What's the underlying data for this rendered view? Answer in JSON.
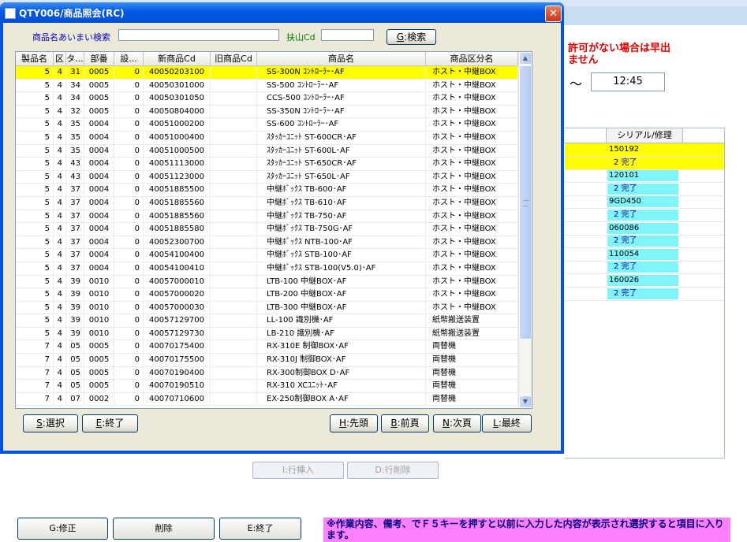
{
  "background": {
    "warning": "許可がない場合は早出\nません",
    "time_tilde": "～",
    "time_value": "12:45",
    "grid_header": "シリアル/修理",
    "grid_rows": [
      {
        "text": "150192",
        "hl": true,
        "cyan": false,
        "status": false
      },
      {
        "text": "2 完了",
        "hl": true,
        "cyan": false,
        "status": true
      },
      {
        "text": "120101",
        "hl": false,
        "cyan": true,
        "status": false
      },
      {
        "text": "2 完了",
        "hl": false,
        "cyan": true,
        "status": true
      },
      {
        "text": "9GD450",
        "hl": false,
        "cyan": true,
        "status": false
      },
      {
        "text": "2 完了",
        "hl": false,
        "cyan": true,
        "status": true
      },
      {
        "text": "060086",
        "hl": false,
        "cyan": true,
        "status": false
      },
      {
        "text": "2 完了",
        "hl": false,
        "cyan": true,
        "status": true
      },
      {
        "text": "110054",
        "hl": false,
        "cyan": true,
        "status": false
      },
      {
        "text": "2 完了",
        "hl": false,
        "cyan": true,
        "status": true
      },
      {
        "text": "160026",
        "hl": false,
        "cyan": true,
        "status": false
      },
      {
        "text": "2 完了",
        "hl": false,
        "cyan": true,
        "status": true
      }
    ],
    "insert_row_btn": "I:行挿入",
    "delete_row_btn": "D:行削除",
    "modify_btn": "G:修正",
    "delete_btn": "削除",
    "end_btn": "E:終了",
    "note": "※作業内容、備考、でＦ５キーを押すと以前に入力した内容が表示され選択すると項目に入ります。"
  },
  "dialog": {
    "title": "QTY006/商品照会(RC)",
    "close_glyph": "✕",
    "search_label": "商品名あいまい検索",
    "search_value": "",
    "code_label": "扶山Cd",
    "code_value": "",
    "search_btn_key": "G",
    "search_btn_label": ":検索",
    "columns": [
      "製品名",
      "区",
      "タ...",
      "部番",
      "設...",
      "新商品Cd",
      "旧商品Cd",
      "商品名",
      "商品区分名"
    ],
    "rows": [
      [
        "5",
        "4",
        "31",
        "0005",
        "0",
        "40050203100",
        "",
        "SS-300N ｺﾝﾄﾛｰﾗｰ･AF",
        "ホスト・中継BOX"
      ],
      [
        "5",
        "4",
        "34",
        "0005",
        "0",
        "40050301000",
        "",
        "SS-500 ｺﾝﾄﾛｰﾗｰ･AF",
        "ホスト・中継BOX"
      ],
      [
        "5",
        "4",
        "34",
        "0005",
        "0",
        "40050301050",
        "",
        "CCS-500 ｺﾝﾄﾛｰﾗｰ･AF",
        "ホスト・中継BOX"
      ],
      [
        "5",
        "4",
        "32",
        "0005",
        "0",
        "40050804000",
        "",
        "SS-350N ｺﾝﾄﾛｰﾗｰ･AF",
        "ホスト・中継BOX"
      ],
      [
        "5",
        "4",
        "35",
        "0004",
        "0",
        "40051000200",
        "",
        "SS-600 ｺﾝﾄﾛｰﾗｰ･AF",
        "ホスト・中継BOX"
      ],
      [
        "5",
        "4",
        "35",
        "0004",
        "0",
        "40051000400",
        "",
        "ｽﾀｯｶｰﾕﾆｯﾄ ST-600CR･AF",
        "ホスト・中継BOX"
      ],
      [
        "5",
        "4",
        "35",
        "0004",
        "0",
        "40051000500",
        "",
        "ｽﾀｯｶｰﾕﾆｯﾄ ST-600L･AF",
        "ホスト・中継BOX"
      ],
      [
        "5",
        "4",
        "43",
        "0004",
        "0",
        "40051113000",
        "",
        "ｽﾀｯｶｰﾕﾆｯﾄ ST-650CR･AF",
        "ホスト・中継BOX"
      ],
      [
        "5",
        "4",
        "43",
        "0004",
        "0",
        "40051123000",
        "",
        "ｽﾀｯｶｰﾕﾆｯﾄ ST-650L･AF",
        "ホスト・中継BOX"
      ],
      [
        "5",
        "4",
        "37",
        "0004",
        "0",
        "40051885500",
        "",
        "中継ﾎﾞｯｸｽ TB-600･AF",
        "ホスト・中継BOX"
      ],
      [
        "5",
        "4",
        "37",
        "0004",
        "0",
        "40051885560",
        "",
        "中継ﾎﾞｯｸｽ TB-610･AF",
        "ホスト・中継BOX"
      ],
      [
        "5",
        "4",
        "37",
        "0004",
        "0",
        "40051885560",
        "",
        "中継ﾎﾞｯｸｽ TB-750･AF",
        "ホスト・中継BOX"
      ],
      [
        "5",
        "4",
        "37",
        "0004",
        "0",
        "40051885580",
        "",
        "中継ﾎﾞｯｸｽ TB-750G･AF",
        "ホスト・中継BOX"
      ],
      [
        "5",
        "4",
        "37",
        "0004",
        "0",
        "40052300700",
        "",
        "中継ﾎﾞｯｸｽ NTB-100･AF",
        "ホスト・中継BOX"
      ],
      [
        "5",
        "4",
        "37",
        "0004",
        "0",
        "40054100400",
        "",
        "中継ﾎﾞｯｸｽ STB-100･AF",
        "ホスト・中継BOX"
      ],
      [
        "5",
        "4",
        "37",
        "0004",
        "0",
        "40054100410",
        "",
        "中継ﾎﾞｯｸｽ STB-100(V5.0)･AF",
        "ホスト・中継BOX"
      ],
      [
        "5",
        "4",
        "39",
        "0010",
        "0",
        "40057000010",
        "",
        "LTB-100 中継BOX･AF",
        "ホスト・中継BOX"
      ],
      [
        "5",
        "4",
        "39",
        "0010",
        "0",
        "40057000020",
        "",
        "LTB-200 中継BOX･AF",
        "ホスト・中継BOX"
      ],
      [
        "5",
        "4",
        "39",
        "0010",
        "0",
        "40057000030",
        "",
        "LTB-300 中継BOX･AF",
        "ホスト・中継BOX"
      ],
      [
        "5",
        "4",
        "39",
        "0010",
        "0",
        "40057129700",
        "",
        "LL-100 識別機･AF",
        "紙幣搬送装置"
      ],
      [
        "5",
        "4",
        "39",
        "0010",
        "0",
        "40057129730",
        "",
        "LB-210 識別機･AF",
        "紙幣搬送装置"
      ],
      [
        "7",
        "4",
        "05",
        "0005",
        "0",
        "40070175400",
        "",
        "RX-310E 制御BOX･AF",
        "両替機"
      ],
      [
        "7",
        "4",
        "05",
        "0005",
        "0",
        "40070175500",
        "",
        "RX-310J 制御BOX･AF",
        "両替機"
      ],
      [
        "7",
        "4",
        "05",
        "0005",
        "0",
        "40070190400",
        "",
        "RX-300制御BOX D･AF",
        "両替機"
      ],
      [
        "7",
        "4",
        "05",
        "0005",
        "0",
        "40070190510",
        "",
        "RX-310 XCﾕﾆｯﾄ･AF",
        "両替機"
      ],
      [
        "7",
        "4",
        "07",
        "0002",
        "0",
        "40070710600",
        "",
        "EX-250制御BOX A･AF",
        "両替機"
      ]
    ],
    "scroll_up": "▲",
    "scroll_down": "▼",
    "btn_select_key": "S",
    "btn_select": ":選択",
    "btn_end_key": "E",
    "btn_end": ":終了",
    "btn_first_key": "H",
    "btn_first": ":先頭",
    "btn_prev_key": "B",
    "btn_prev": ":前頁",
    "btn_next_key": "N",
    "btn_next": ":次頁",
    "btn_last_key": "L",
    "btn_last": ":最終"
  }
}
